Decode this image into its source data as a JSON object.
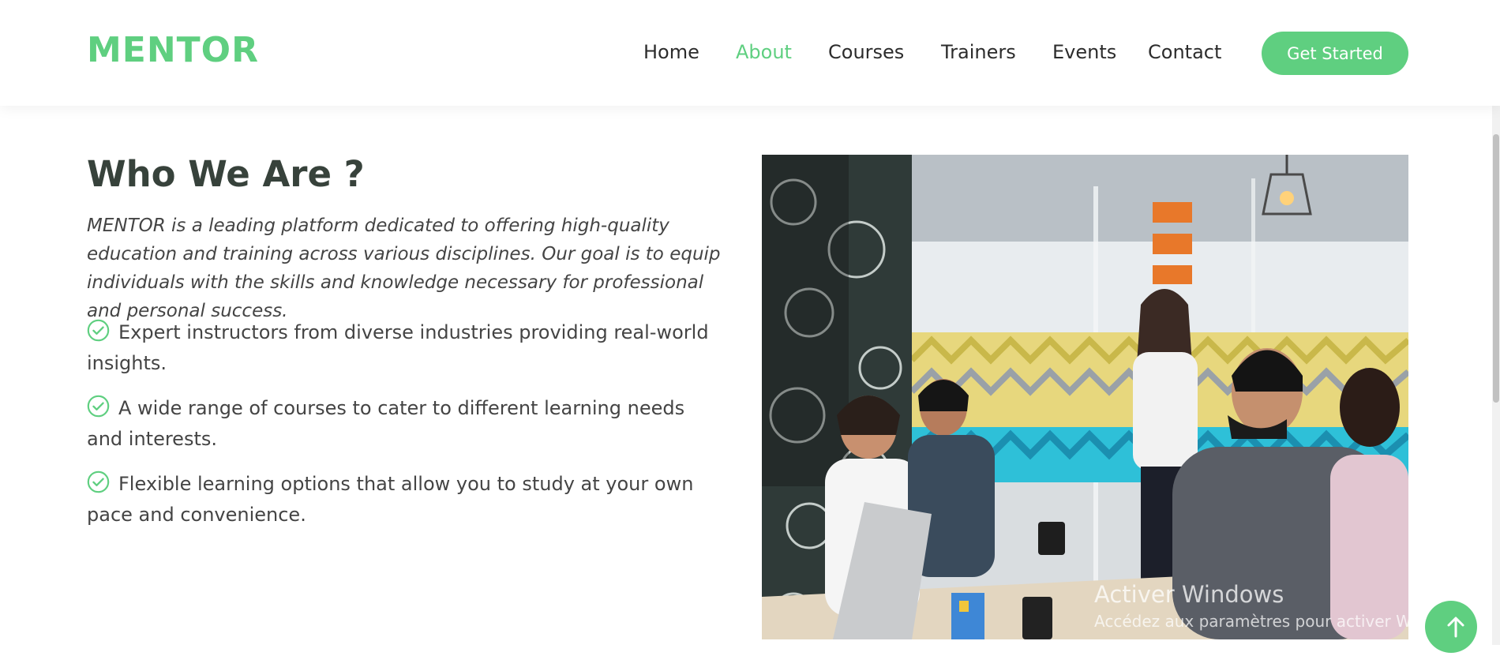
{
  "brand": {
    "name": "MENTOR",
    "accent_color": "#5fcf80"
  },
  "nav": {
    "items": [
      "Home",
      "About",
      "Courses",
      "Trainers",
      "Events",
      "Contact"
    ],
    "active": "About",
    "cta_label": "Get Started"
  },
  "about": {
    "title": "Who We Are ?",
    "intro": "MENTOR is a leading platform dedicated to offering high-quality education and training across various disciplines. Our goal is to equip individuals with the skills and knowledge necessary for professional and personal success.",
    "features": [
      "Expert instructors from diverse industries providing real-world insights.",
      "A wide range of courses to cater to different learning needs and interests.",
      "Flexible learning options that allow you to study at your own pace and convenience."
    ],
    "feature_icon": "check-circle-icon",
    "image_subject": "meeting-room-photo"
  },
  "watermark": {
    "title": "Activer Windows",
    "subtitle": "Accédez aux paramètres pour activer Windows."
  },
  "back_to_top_icon": "arrow-up-icon"
}
